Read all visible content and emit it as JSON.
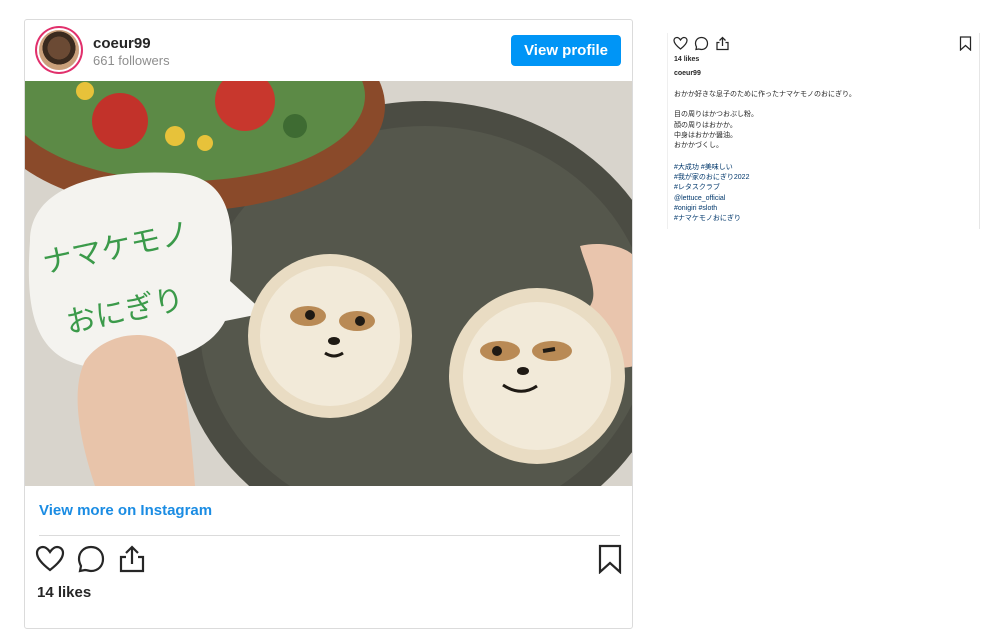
{
  "post": {
    "username": "coeur99",
    "followers": "661 followers",
    "view_profile_label": "View profile",
    "view_more_label": "View more on Instagram",
    "likes": "14 likes",
    "image_alt": "ナマケモノおにぎり",
    "image_note_text": [
      "ナマケモノ",
      "おにぎり"
    ]
  },
  "sidebar": {
    "likes": "14 likes",
    "username": "coeur99",
    "caption_lines": "おかか好きな息子のために作ったナマケモノのおにぎり。\n\n目の周りはかつおぶし粉。\n顔の周りはおかか。\n中身はおかか醤油。\nおかかづくし。",
    "hashtags": [
      "#大成功 #美味しい",
      "#我が家のおにぎり2022",
      "#レタスクラブ",
      "@lettuce_official",
      "#onigiri #sloth",
      "#ナマケモノおにぎり"
    ]
  },
  "icons": {
    "like": "heart-icon",
    "comment": "comment-icon",
    "share": "share-icon",
    "save": "bookmark-icon"
  },
  "colors": {
    "accent": "#0095f6",
    "link": "#1a8ce3",
    "hashtag": "#00376b"
  }
}
